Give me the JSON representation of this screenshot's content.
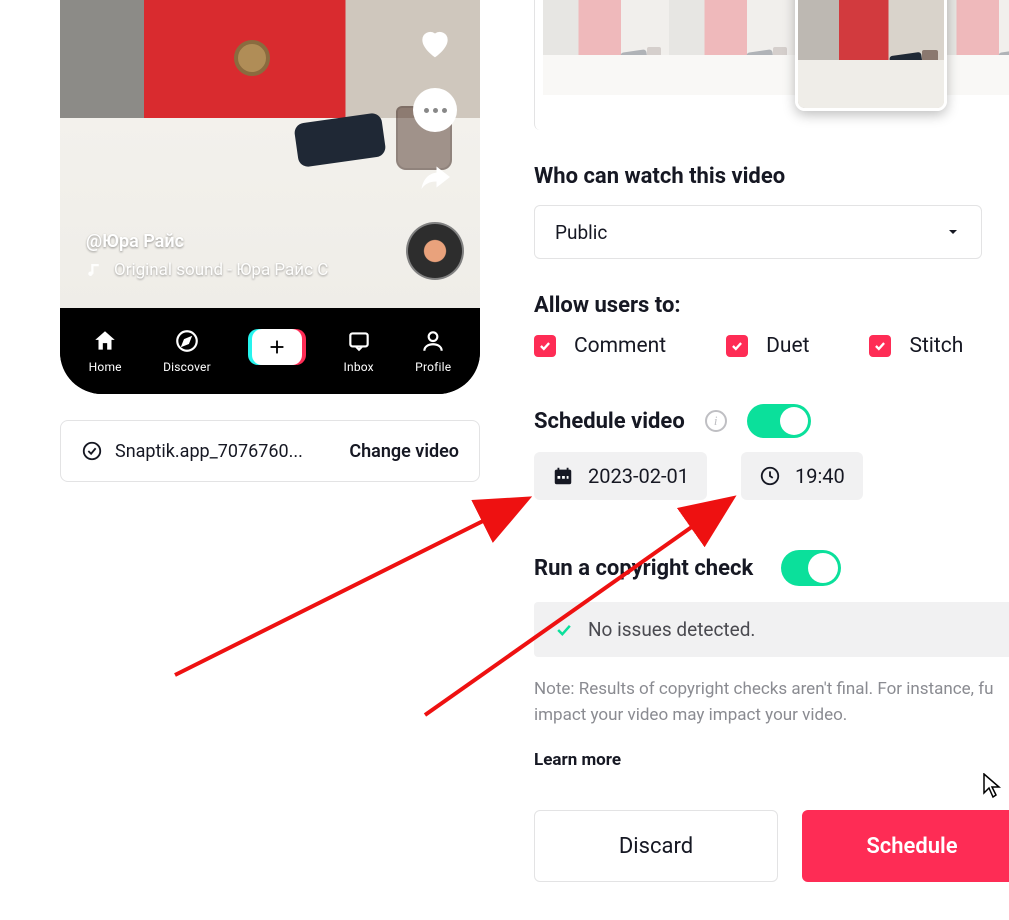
{
  "preview": {
    "user_handle": "@Юра Райс",
    "sound_text": "Original sound - Юра Райс С",
    "tabs": {
      "home": "Home",
      "discover": "Discover",
      "inbox": "Inbox",
      "profile": "Profile"
    }
  },
  "file": {
    "name": "Snaptik.app_7076760...",
    "change_label": "Change video"
  },
  "privacy": {
    "title": "Who can watch this video",
    "selected": "Public"
  },
  "allow": {
    "title": "Allow users to:",
    "comment": "Comment",
    "duet": "Duet",
    "stitch": "Stitch"
  },
  "schedule": {
    "title": "Schedule video",
    "date": "2023-02-01",
    "time": "19:40"
  },
  "copyright": {
    "title": "Run a copyright check",
    "result": "No issues detected.",
    "note": "Note: Results of copyright checks aren't final. For instance, fu impact your video may impact your video.",
    "learn_more": "Learn more"
  },
  "buttons": {
    "discard": "Discard",
    "schedule": "Schedule"
  }
}
